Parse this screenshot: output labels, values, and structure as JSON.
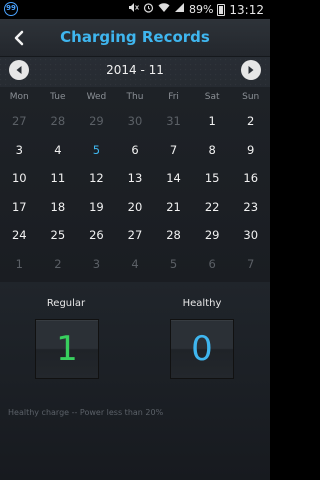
{
  "status_bar": {
    "notification_badge": "99",
    "battery": "89%",
    "time": "13:12",
    "icons": [
      "mute-icon",
      "alarm-icon",
      "wifi-icon",
      "signal-icon",
      "battery-icon"
    ]
  },
  "header": {
    "title": "Charging Records",
    "back_icon": "chevron-left-icon"
  },
  "month_nav": {
    "label": "2014 - 11",
    "prev_icon": "triangle-left-icon",
    "next_icon": "triangle-right-icon"
  },
  "calendar": {
    "weekdays": [
      "Mon",
      "Tue",
      "Wed",
      "Thu",
      "Fri",
      "Sat",
      "Sun"
    ],
    "weeks": [
      [
        {
          "d": "27",
          "m": true
        },
        {
          "d": "28",
          "m": true
        },
        {
          "d": "29",
          "m": true
        },
        {
          "d": "30",
          "m": true
        },
        {
          "d": "31",
          "m": true
        },
        {
          "d": "1"
        },
        {
          "d": "2"
        }
      ],
      [
        {
          "d": "3"
        },
        {
          "d": "4"
        },
        {
          "d": "5",
          "t": true
        },
        {
          "d": "6"
        },
        {
          "d": "7"
        },
        {
          "d": "8"
        },
        {
          "d": "9"
        }
      ],
      [
        {
          "d": "10"
        },
        {
          "d": "11"
        },
        {
          "d": "12"
        },
        {
          "d": "13"
        },
        {
          "d": "14"
        },
        {
          "d": "15"
        },
        {
          "d": "16"
        }
      ],
      [
        {
          "d": "17"
        },
        {
          "d": "18"
        },
        {
          "d": "19"
        },
        {
          "d": "20"
        },
        {
          "d": "21"
        },
        {
          "d": "22"
        },
        {
          "d": "23"
        }
      ],
      [
        {
          "d": "24"
        },
        {
          "d": "25"
        },
        {
          "d": "26"
        },
        {
          "d": "27"
        },
        {
          "d": "28"
        },
        {
          "d": "29"
        },
        {
          "d": "30"
        }
      ],
      [
        {
          "d": "1",
          "m": true
        },
        {
          "d": "2",
          "m": true
        },
        {
          "d": "3",
          "m": true
        },
        {
          "d": "4",
          "m": true
        },
        {
          "d": "5",
          "m": true
        },
        {
          "d": "6",
          "m": true
        },
        {
          "d": "7",
          "m": true
        }
      ]
    ]
  },
  "stats": {
    "regular_label": "Regular",
    "regular_value": "1",
    "healthy_label": "Healthy",
    "healthy_value": "0",
    "note": "Healthy charge -- Power less than 20%"
  },
  "colors": {
    "accent": "#3fb6ef",
    "regular": "#38cf5e",
    "muted_day": "#5b6066"
  }
}
